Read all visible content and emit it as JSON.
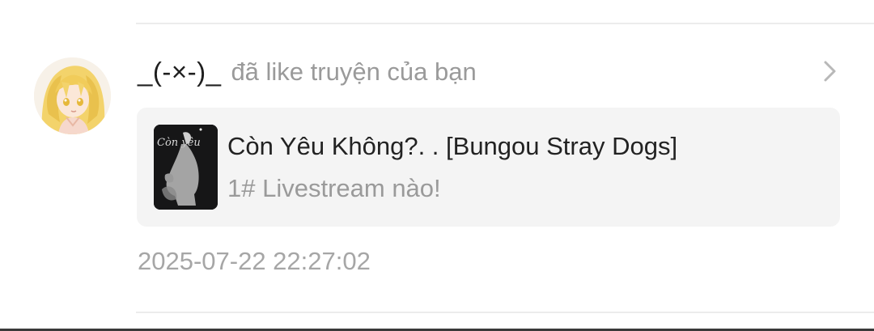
{
  "notification": {
    "user": {
      "name": "_(-×-)_",
      "avatar_icon": "anime-girl-avatar"
    },
    "action_text": "đã like truyện của bạn",
    "chevron_icon": "chevron-right-icon",
    "story": {
      "title": "Còn Yêu Không?. . [Bungou Stray Dogs]",
      "chapter": "1# Livestream nào!",
      "cover_text": "Còn yêu",
      "cover_icon": "story-cover-image"
    },
    "timestamp": "2025-07-22 22:27:02"
  },
  "colors": {
    "background": "#ffffff",
    "card_background": "#f4f4f4",
    "username": "#1f1f1f",
    "secondary_text": "#9a9a9a",
    "divider": "#ececec"
  }
}
